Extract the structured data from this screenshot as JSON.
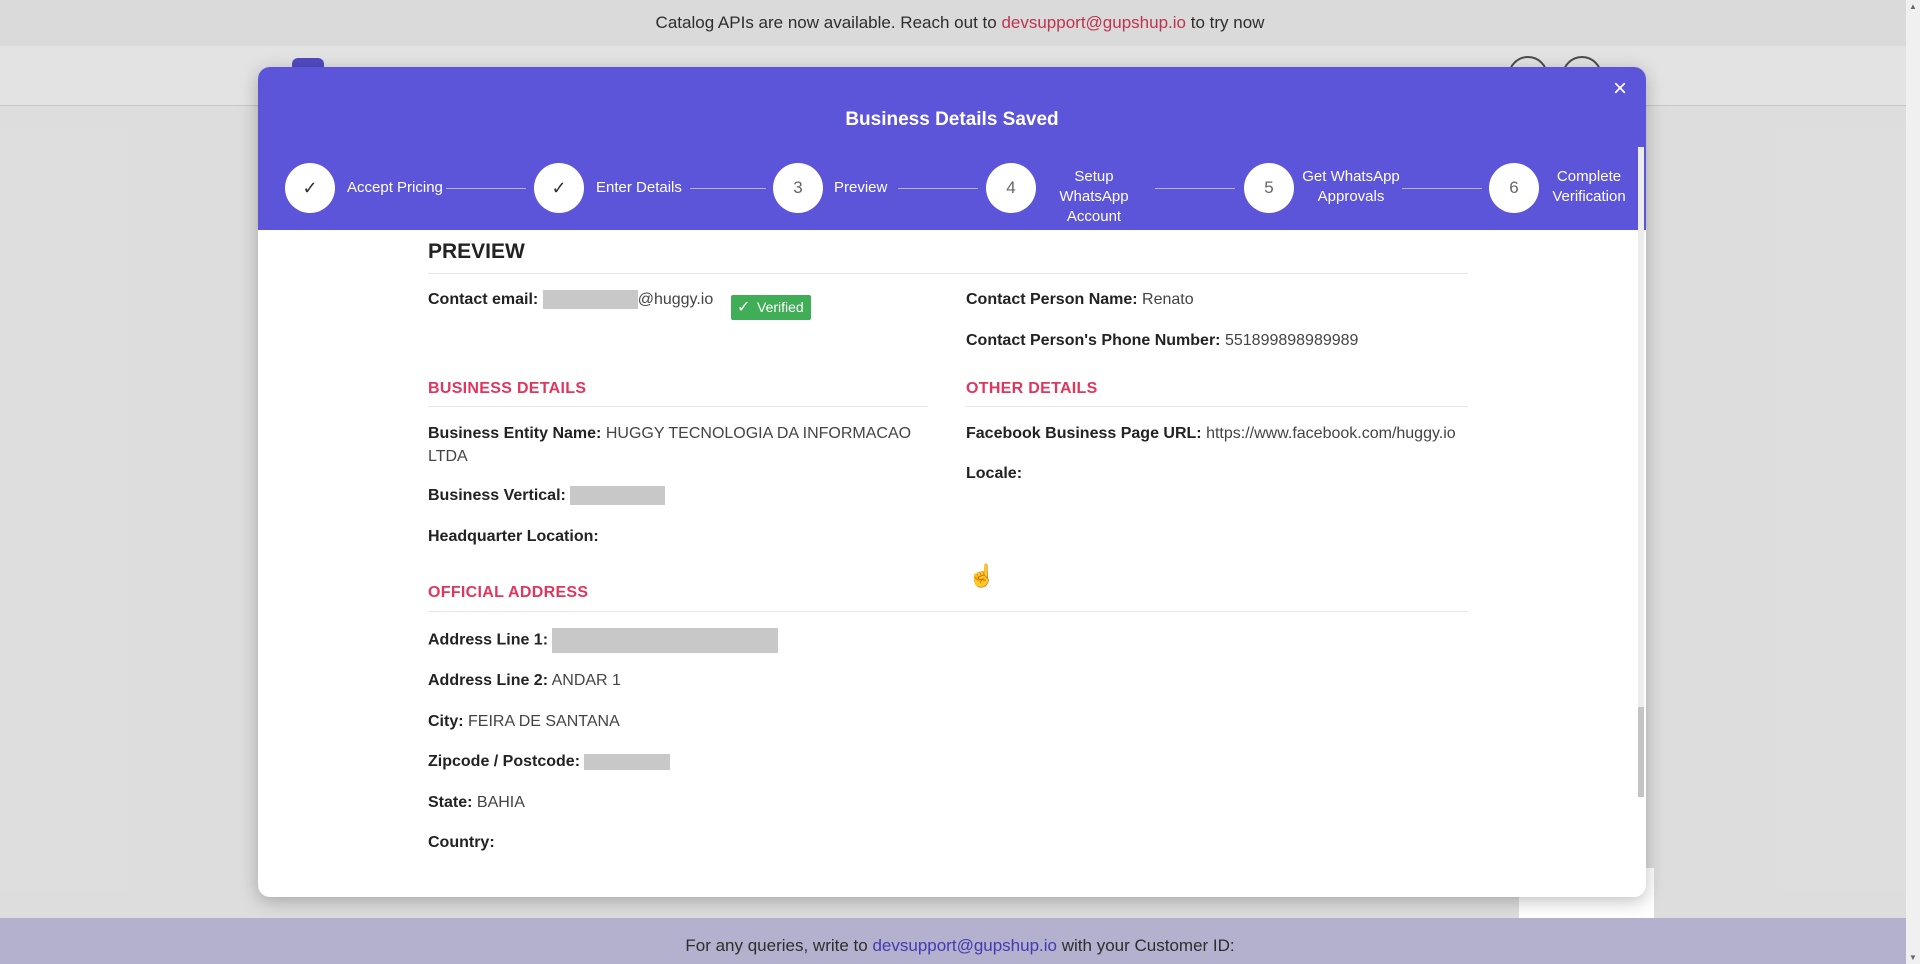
{
  "banner": {
    "text_before": "Catalog APIs are now available. Reach out to",
    "email": "devsupport@gupshup.io",
    "text_after": "to try now"
  },
  "modal": {
    "title": "Business Details Saved",
    "close_icon": "close-icon",
    "steps": [
      {
        "number": "✓",
        "label": "Accept Pricing",
        "status": "done"
      },
      {
        "number": "✓",
        "label": "Enter Details",
        "status": "done"
      },
      {
        "number": "3",
        "label": "Preview",
        "status": "active"
      },
      {
        "number": "4",
        "label_line1": "Setup WhatsApp",
        "label_line2": "Account",
        "status": "pending"
      },
      {
        "number": "5",
        "label_line1": "Get WhatsApp",
        "label_line2": "Approvals",
        "status": "pending"
      },
      {
        "number": "6",
        "label_line1": "Complete",
        "label_line2": "Verification",
        "status": "pending"
      }
    ]
  },
  "preview": {
    "heading": "PREVIEW",
    "contact_email_label": "Contact email:",
    "contact_email_domain": "@huggy.io",
    "verified_label": "Verified",
    "contact_person_name_label": "Contact Person Name:",
    "contact_person_name": "Renato",
    "contact_phone_label": "Contact Person's Phone Number:",
    "contact_phone": "551899898989989",
    "business_details": {
      "heading": "BUSINESS DETAILS",
      "entity_name_label": "Business Entity Name:",
      "entity_name_line1": "HUGGY TECNOLOGIA DA INFORMACAO",
      "entity_name_line2": "LTDA",
      "vertical_label": "Business Vertical:",
      "hq_label": "Headquarter Location:"
    },
    "other_details": {
      "heading": "OTHER DETAILS",
      "fb_label": "Facebook Business Page URL:",
      "fb_url": "https://www.facebook.com/huggy.io",
      "locale_label": "Locale:"
    },
    "official_address": {
      "heading": "OFFICIAL ADDRESS",
      "line1_label": "Address Line 1:",
      "line2_label": "Address Line 2:",
      "line2": "ANDAR 1",
      "city_label": "City:",
      "city": "FEIRA DE SANTANA",
      "zip_label": "Zipcode / Postcode:",
      "state_label": "State:",
      "state": "BAHIA",
      "country_label": "Country:"
    }
  },
  "footer": {
    "text_before": "For any queries, write to",
    "email": "devsupport@gupshup.io",
    "text_after": "with your Customer ID:"
  },
  "colors": {
    "accent": "#5c54d9",
    "section_heading": "#e0365e",
    "verified_badge": "#3fae56",
    "link": "#d33a5a"
  }
}
